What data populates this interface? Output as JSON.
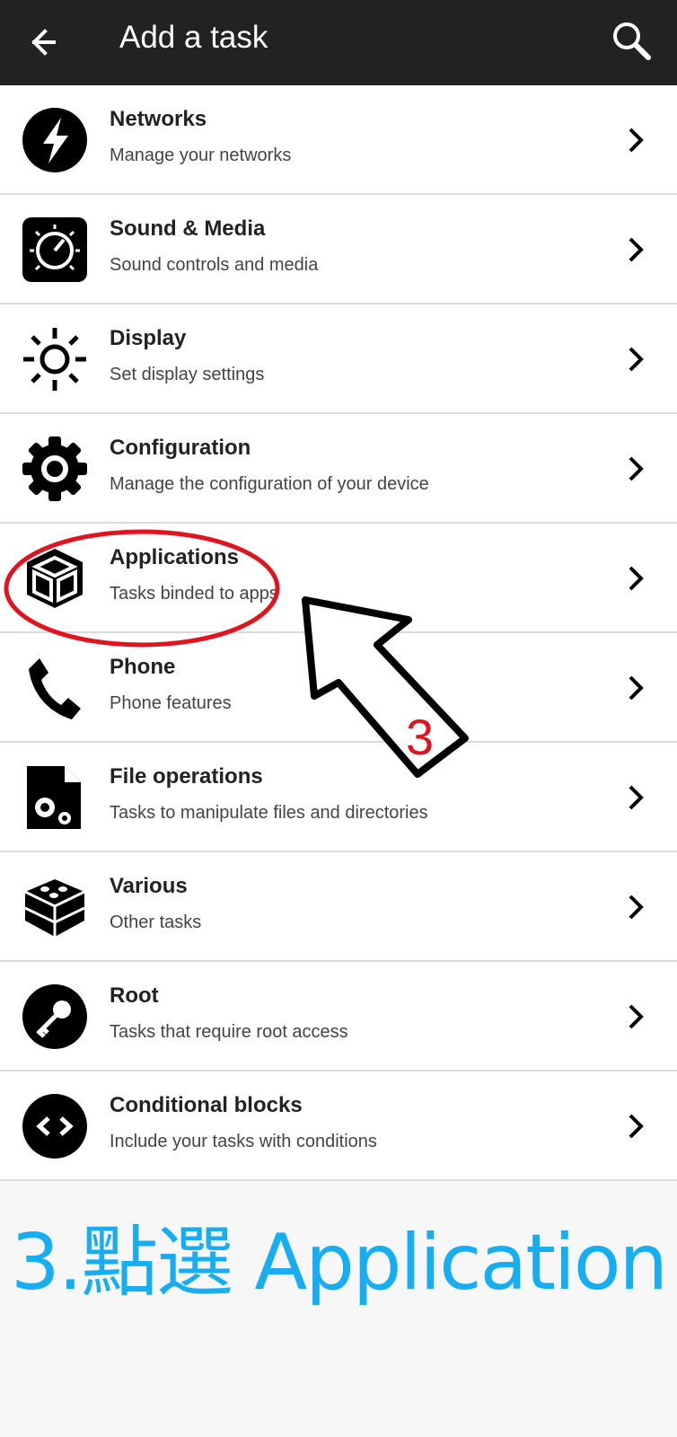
{
  "header": {
    "title": "Add a task",
    "back_icon": "arrow-left-icon",
    "search_icon": "search-icon",
    "background": "#222222"
  },
  "items": [
    {
      "label": "Networks",
      "sub": "Manage your networks",
      "icon": "lightning-icon"
    },
    {
      "label": "Sound & Media",
      "sub": "Sound controls and media",
      "icon": "speaker-knob-icon"
    },
    {
      "label": "Display",
      "sub": "Set display settings",
      "icon": "sun-brightness-icon"
    },
    {
      "label": "Configuration",
      "sub": "Manage the configuration of your device",
      "icon": "gear-icon"
    },
    {
      "label": "Applications",
      "sub": "Tasks binded to apps",
      "icon": "cube-icon"
    },
    {
      "label": "Phone",
      "sub": "Phone features",
      "icon": "phone-icon"
    },
    {
      "label": "File operations",
      "sub": "Tasks to manipulate files and directories",
      "icon": "file-gear-icon"
    },
    {
      "label": "Various",
      "sub": "Other tasks",
      "icon": "bricks-icon"
    },
    {
      "label": "Root",
      "sub": "Tasks that require root access",
      "icon": "key-icon"
    },
    {
      "label": "Conditional blocks",
      "sub": "Include your tasks with conditions",
      "icon": "code-brackets-icon"
    }
  ],
  "annotation": {
    "step_number": "3",
    "caption": "3.點選 Application",
    "highlight_color": "#e0141e",
    "caption_color": "#16aef0"
  }
}
